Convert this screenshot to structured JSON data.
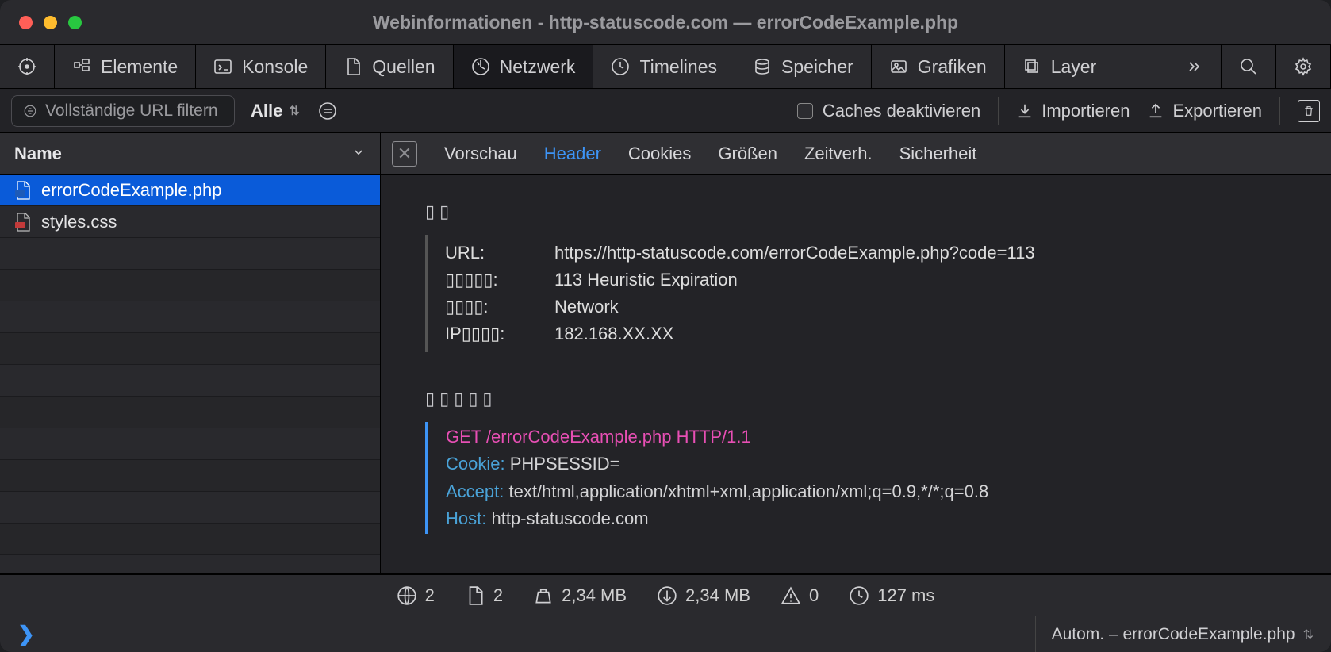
{
  "window_title": "Webinformationen - http-statuscode.com — errorCodeExample.php",
  "tabs": {
    "elements": "Elemente",
    "console": "Konsole",
    "sources": "Quellen",
    "network": "Netzwerk",
    "timelines": "Timelines",
    "storage": "Speicher",
    "graphics": "Grafiken",
    "layers": "Layer"
  },
  "filter": {
    "placeholder": "Vollständige URL filtern",
    "all": "Alle",
    "disable_caches": "Caches deaktivieren",
    "import": "Importieren",
    "export": "Exportieren"
  },
  "sidebar": {
    "header": "Name",
    "items": [
      {
        "name": "errorCodeExample.php",
        "type": "php",
        "selected": true
      },
      {
        "name": "styles.css",
        "type": "css",
        "selected": false
      }
    ]
  },
  "detail_tabs": {
    "preview": "Vorschau",
    "header": "Header",
    "cookies": "Cookies",
    "sizes": "Größen",
    "timing": "Zeitverh.",
    "security": "Sicherheit"
  },
  "summary": {
    "section_title": "▯▯",
    "url_label": "URL:",
    "url_value": "https://http-statuscode.com/errorCodeExample.php?code=113",
    "status_label": "▯▯▯▯▯:",
    "status_value": "113 Heuristic Expiration",
    "source_label": "▯▯▯▯:",
    "source_value": "Network",
    "ip_label": "IP▯▯▯▯:",
    "ip_value": "182.168.XX.XX"
  },
  "request": {
    "section_title": "▯▯▯▯▯",
    "first_line": "GET /errorCodeExample.php HTTP/1.1",
    "headers": [
      {
        "key": "Cookie:",
        "value": "PHPSESSID="
      },
      {
        "key": "Accept:",
        "value": "text/html,application/xhtml+xml,application/xml;q=0.9,*/*;q=0.8"
      },
      {
        "key": "Host:",
        "value": "http-statuscode.com"
      }
    ]
  },
  "status": {
    "domains": "2",
    "resources": "2",
    "size": "2,34 MB",
    "transferred": "2,34 MB",
    "errors": "0",
    "time": "127 ms"
  },
  "console": {
    "context": "Autom. – errorCodeExample.php"
  }
}
